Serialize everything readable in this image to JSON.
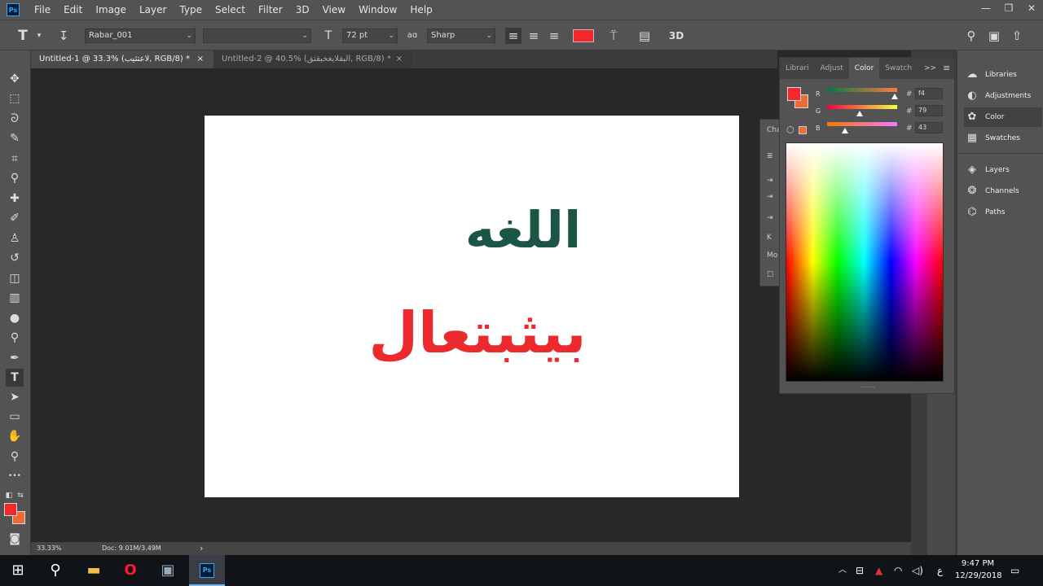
{
  "app": {
    "logo": "Ps"
  },
  "menu": [
    "File",
    "Edit",
    "Image",
    "Layer",
    "Type",
    "Select",
    "Filter",
    "3D",
    "View",
    "Window",
    "Help"
  ],
  "window_controls": [
    "—",
    "❐",
    "✕"
  ],
  "options": {
    "font_family": "Rabar_001",
    "font_style": "",
    "font_size": "72 pt",
    "aa_label": "aɑ",
    "antialias": "Sharp",
    "text_color": "#f4272c",
    "threed": "3D"
  },
  "tabs": [
    {
      "label": "Untitled-1 @ 33.3% (لاعتثيب, RGB/8) *",
      "close": "×"
    },
    {
      "label": "Untitled-2 @ 40.5% (البقلايغخبقتق, RGB/8) *",
      "close": "×"
    }
  ],
  "canvas": {
    "line1": "اللغه",
    "line2": "بيثبتعال",
    "line1_color": "#1a5546",
    "line2_color": "#ec2a2e"
  },
  "status": {
    "zoom": "33.33%",
    "doc": "Doc: 9.01M/3.49M",
    "arrow": "›"
  },
  "toolbar": {
    "foreground": "#f4272c",
    "background": "#ef6b35",
    "more": "•••"
  },
  "char_panel": {
    "title": "Cha",
    "k": "K",
    "m": "Mo"
  },
  "color_panel": {
    "tabs": [
      "Librari",
      "Adjust",
      "Color",
      "Swatch"
    ],
    "active_tab": "Color",
    "expand": ">>",
    "menu": "≡",
    "r_label": "R",
    "g_label": "G",
    "b_label": "B",
    "hash": "#",
    "r_value": "f4",
    "g_value": "79",
    "b_value": "43",
    "r_level": 0.96,
    "g_level": 0.47,
    "b_level": 0.26
  },
  "dock": [
    "Libraries",
    "Adjustments",
    "Color",
    "Swatches",
    "Layers",
    "Channels",
    "Paths"
  ],
  "taskbar": {
    "time": "9:47 PM",
    "date": "12/29/2018",
    "lang": "ع",
    "ps_label": "Ps"
  }
}
